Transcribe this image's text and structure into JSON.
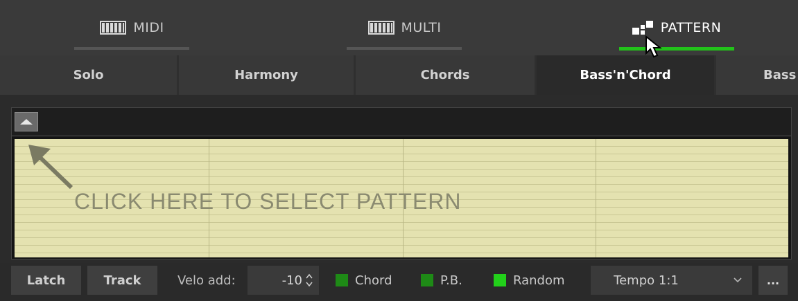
{
  "mode_tabs": [
    {
      "label": "MIDI",
      "icon": "piano-keys-icon",
      "active": false
    },
    {
      "label": "MULTI",
      "icon": "piano-keys-icon",
      "active": false
    },
    {
      "label": "PATTERN",
      "icon": "pattern-blocks-icon",
      "active": true
    }
  ],
  "sub_tabs": [
    {
      "label": "Solo",
      "active": false
    },
    {
      "label": "Harmony",
      "active": false
    },
    {
      "label": "Chords",
      "active": false
    },
    {
      "label": "Bass'n'Chord",
      "active": true
    },
    {
      "label": "Bass",
      "active": false
    }
  ],
  "pattern": {
    "hint": "CLICK HERE TO SELECT PATTERN",
    "collapse_icon": "triangle-up-icon"
  },
  "toolbar": {
    "latch_label": "Latch",
    "track_label": "Track",
    "velo_label": "Velo add:",
    "velo_value": "-10",
    "chord_label": "Chord",
    "pb_label": "P.B.",
    "random_label": "Random",
    "tempo_value": "Tempo 1:1",
    "more_label": "..."
  },
  "colors": {
    "accent_green": "#22c21a",
    "chord_box": "#1e8a16",
    "pb_box": "#1e8a16",
    "random_box": "#22d01a",
    "grid_bg": "#e4e2b0"
  }
}
